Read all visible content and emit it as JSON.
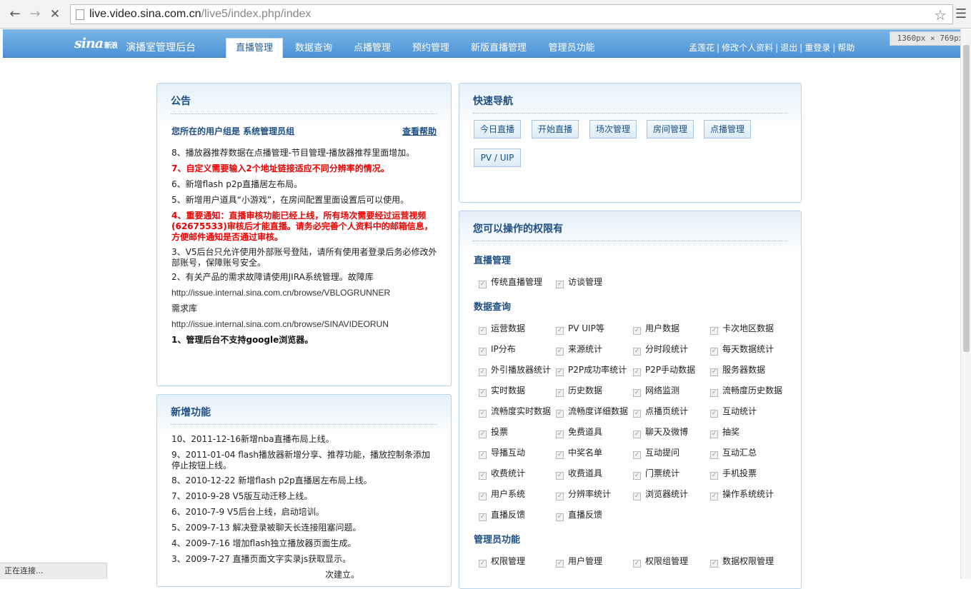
{
  "browser": {
    "url_host": "live.video.sina.com.cn",
    "url_path": "/live5/index.php/index",
    "size_badge": "1360px × 769px",
    "status": "正在连接..."
  },
  "header": {
    "logo": "sina",
    "logo_sub": "新浪",
    "app_title": "演播室管理后台",
    "tabs": [
      "直播管理",
      "数据查询",
      "点播管理",
      "预约管理",
      "新版直播管理",
      "管理员功能"
    ],
    "active_tab": "直播管理",
    "user_links": [
      "孟莲花",
      "修改个人资料",
      "退出",
      "重登录",
      "帮助"
    ]
  },
  "announcement": {
    "title": "公告",
    "user_group": "您所在的用户组是 系统管理员组",
    "help_link": "查看帮助",
    "items": [
      {
        "text": "8、播放器推荐数据在点播管理-节目管理-播放器推荐里面增加。",
        "style": "normal"
      },
      {
        "text": "7、自定义需要输入2个地址链接适应不同分辨率的情况。",
        "style": "red"
      },
      {
        "text": "6、新增flash p2p直播居左布局。",
        "style": "normal"
      },
      {
        "text": "5、新增用户道具“小游戏”，在房间配置里面设置后可以使用。",
        "style": "normal"
      },
      {
        "text": "4、重要通知：直播审核功能已经上线，所有场次需要经过运营视频(62675533)审核后才能直播。请务必完善个人资料中的邮箱信息，方便邮件通知是否通过审核。",
        "style": "red"
      },
      {
        "text": "3、V5后台只允许使用外部账号登陆，请所有使用者登录后务必修改外部账号，保障账号安全。",
        "style": "normal"
      },
      {
        "text": "2、有关产品的需求故障请使用JIRA系统管理。故障库",
        "style": "normal"
      },
      {
        "text": "http://issue.internal.sina.com.cn/browse/VBLOGRUNNER",
        "style": "url"
      },
      {
        "text": "需求库",
        "style": "normal"
      },
      {
        "text": "http://issue.internal.sina.com.cn/browse/SINAVIDEORUN",
        "style": "url"
      },
      {
        "text": "1、管理后台不支持google浏览器。",
        "style": "bold"
      }
    ]
  },
  "new_features": {
    "title": "新增功能",
    "items": [
      "10、2011-12-16新增nba直播布局上线。",
      "9、2011-01-04 flash播放器新增分享、推荐功能，播放控制条添加停止按钮上线。",
      "8、2010-12-22 新增flash p2p直播居左布局上线。",
      "7、2010-9-28 V5版互动迁移上线。",
      "6、2010-7-9 V5后台上线，启动培训。",
      "5、2009-7-13 解决登录被聊天长连接阻塞问题。",
      "4、2009-7-16 增加flash独立播放器页面生成。",
      "3、2009-7-27 直播页面文字实录js获取显示。",
      "次建立。"
    ]
  },
  "quick_nav": {
    "title": "快速导航",
    "buttons": [
      "今日直播",
      "开始直播",
      "场次管理",
      "房间管理",
      "点播管理",
      "PV / UIP"
    ]
  },
  "permissions": {
    "title": "您可以操作的权限有",
    "sections": [
      {
        "name": "直播管理",
        "items": [
          "传统直播管理",
          "访谈管理"
        ]
      },
      {
        "name": "数据查询",
        "items": [
          "运营数据",
          "PV UIP等",
          "用户数据",
          "卡次地区数据",
          "IP分布",
          "来源统计",
          "分时段统计",
          "每天数据统计",
          "外引播放器统计",
          "P2P成功率统计",
          "P2P手动数据",
          "服务器数据",
          "实时数据",
          "历史数据",
          "网络监测",
          "流畅度历史数据",
          "流畅度实时数据",
          "流畅度详细数据",
          "点播页统计",
          "互动统计",
          "投票",
          "免费道具",
          "聊天及微博",
          "抽奖",
          "导播互动",
          "中奖名单",
          "互动提问",
          "互动汇总",
          "收费统计",
          "收费道具",
          "门票统计",
          "手机投票",
          "用户系统",
          "分辨率统计",
          "浏览器统计",
          "操作系统统计",
          "直播反馈",
          "直播反馈"
        ]
      },
      {
        "name": "管理员功能",
        "items": [
          "权限管理",
          "用户管理",
          "权限组管理",
          "数据权限管理"
        ]
      }
    ]
  }
}
